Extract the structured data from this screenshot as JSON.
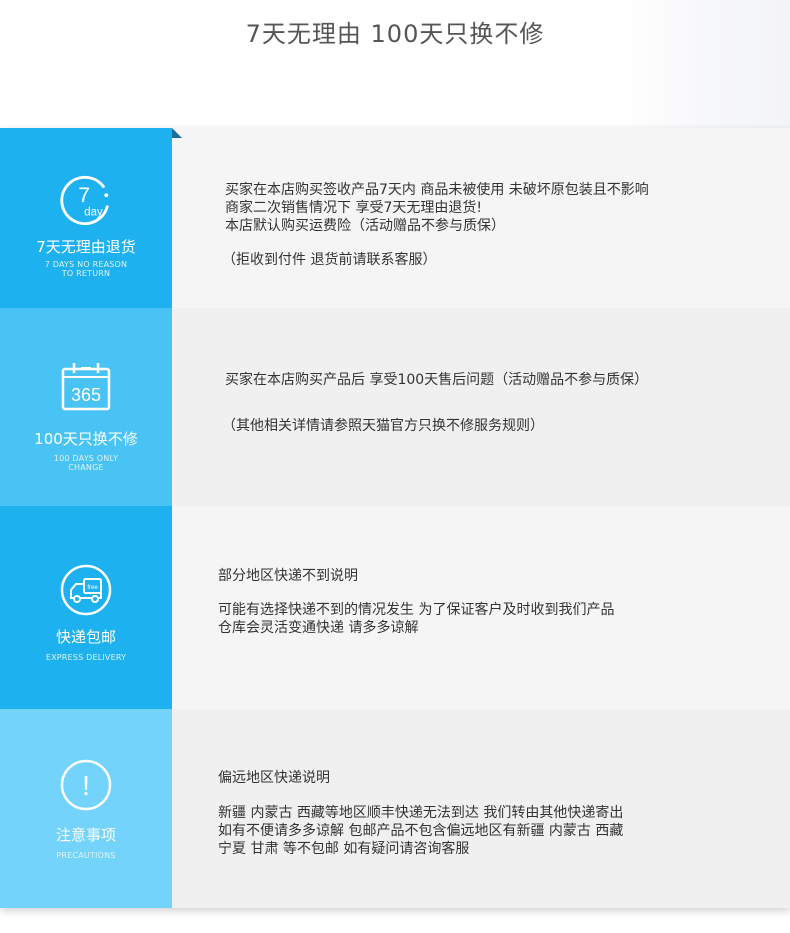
{
  "header": {
    "title": "7天无理由 100天只换不修"
  },
  "sections": [
    {
      "icon": "clock-7-day-icon",
      "icon_number": "7",
      "icon_unit": "day",
      "title_cn": "7天无理由退货",
      "title_en_line1": "7 DAYS NO REASON",
      "title_en_line2": "TO RETURN",
      "lines": [
        "买家在本店购买签收产品7天内 商品未被使用 未破坏原包装且不影响",
        "商家二次销售情况下 享受7天无理由退货!",
        "本店默认购买运费险（活动赠品不参与质保）"
      ],
      "note": "（拒收到付件 退货前请联系客服）"
    },
    {
      "icon": "calendar-365-icon",
      "icon_number": "365",
      "title_cn": "100天只换不修",
      "title_en_line1": "100 DAYS ONLY",
      "title_en_line2": "CHANGE",
      "lines": [
        "买家在本店购买产品后  享受100天售后问题（活动赠品不参与质保）"
      ],
      "note": "（其他相关详情请参照天猫官方只换不修服务规则）"
    },
    {
      "icon": "delivery-truck-icon",
      "icon_badge": "free",
      "title_cn": "快递包邮",
      "title_en_line1": "EXPRESS DELIVERY",
      "heading": "部分地区快递不到说明",
      "lines": [
        "可能有选择快递不到的情况发生 为了保证客户及时收到我们产品",
        "仓库会灵活变通快递 请多多谅解"
      ]
    },
    {
      "icon": "exclamation-icon",
      "icon_symbol": "!",
      "title_cn": "注意事项",
      "title_en_line1": "PRECAUTIONS",
      "heading": "偏远地区快递说明",
      "lines": [
        "新疆 内蒙古 西藏等地区顺丰快递无法到达 我们转由其他快递寄出",
        "如有不便请多多谅解  包邮产品不包含偏远地区有新疆 内蒙古 西藏",
        "宁夏 甘肃 等不包邮 如有疑问请咨询客服"
      ]
    }
  ]
}
